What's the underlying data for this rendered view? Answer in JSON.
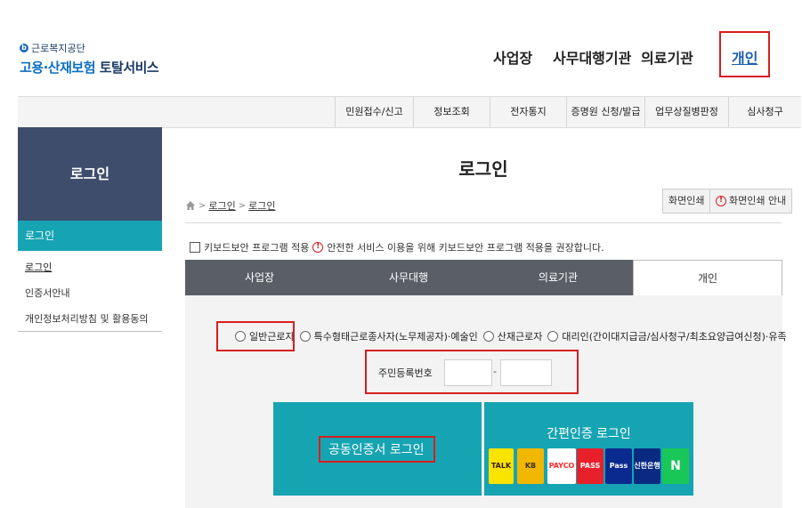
{
  "logo": {
    "org": "근로복지공단",
    "title_main": "고용·산재보험",
    "title_sub": "토탈서비스"
  },
  "topnav": [
    {
      "label": "사업장"
    },
    {
      "label": "사무대행기관"
    },
    {
      "label": "의료기관"
    },
    {
      "label": "개인"
    }
  ],
  "subnav": [
    {
      "label": "민원접수/신고"
    },
    {
      "label": "정보조회"
    },
    {
      "label": "전자통지"
    },
    {
      "label": "증명원 신청/발급"
    },
    {
      "label": "업무상질병판정"
    },
    {
      "label": "심사청구"
    }
  ],
  "sidebar": {
    "title": "로그인",
    "active": "로그인",
    "links": [
      {
        "label": "로그인"
      },
      {
        "label": "인증서안내"
      },
      {
        "label": "개인정보처리방침 및 활용동의"
      }
    ]
  },
  "page": {
    "title": "로그인",
    "breadcrumb": [
      "로그인",
      "로그인"
    ],
    "print_label": "화면인쇄",
    "print_help_label": "화면인쇄 안내",
    "keyboard_label": "키보드보안 프로그램 적용",
    "keyboard_notice": "안전한 서비스 이용을 위해 키보드보안 프로그램 적용을 권장합니다."
  },
  "tabs": [
    {
      "label": "사업장"
    },
    {
      "label": "사무대행"
    },
    {
      "label": "의료기관"
    },
    {
      "label": "개인"
    }
  ],
  "login_types": [
    {
      "label": "일반근로자"
    },
    {
      "label": "특수형태근로종사자(노무제공자)·예술인"
    },
    {
      "label": "산재근로자"
    },
    {
      "label": "대리인(간이대지급금/심사청구/최초요양급여신청)·유족"
    }
  ],
  "rrn": {
    "label": "주민등록번호",
    "front_value": "",
    "back_value": "",
    "separator": "-"
  },
  "buttons": {
    "cert_login": "공동인증서 로그인",
    "simple_login": "간편인증 로그인"
  },
  "providers": [
    {
      "name": "TALK",
      "icon": "kakao-icon",
      "bg": "#fbe300",
      "fg": "#3a1d1d"
    },
    {
      "name": "KB",
      "icon": "kb-icon",
      "bg": "#f2b700",
      "fg": "#3d3219"
    },
    {
      "name": "PAYCO",
      "icon": "payco-icon",
      "bg": "#ffffff",
      "fg": "#ff2a2a"
    },
    {
      "name": "PASS",
      "icon": "pass-icon",
      "bg": "#e8202a",
      "fg": "#ffffff"
    },
    {
      "name": "Pass",
      "icon": "pass-sub-icon",
      "bg": "#0b2a8f",
      "fg": "#ffffff"
    },
    {
      "name": "신한은행",
      "icon": "shinhan-icon",
      "bg": "#0a2a82",
      "fg": "#ffffff"
    },
    {
      "name": "N",
      "icon": "naver-icon",
      "bg": "#19c759",
      "fg": "#ffffff"
    }
  ],
  "colors": {
    "accent": "#16a4b2",
    "sidebar_dark": "#3f4d6c",
    "highlight_box": "#d81e1e",
    "active_link": "#1d5fb0"
  }
}
